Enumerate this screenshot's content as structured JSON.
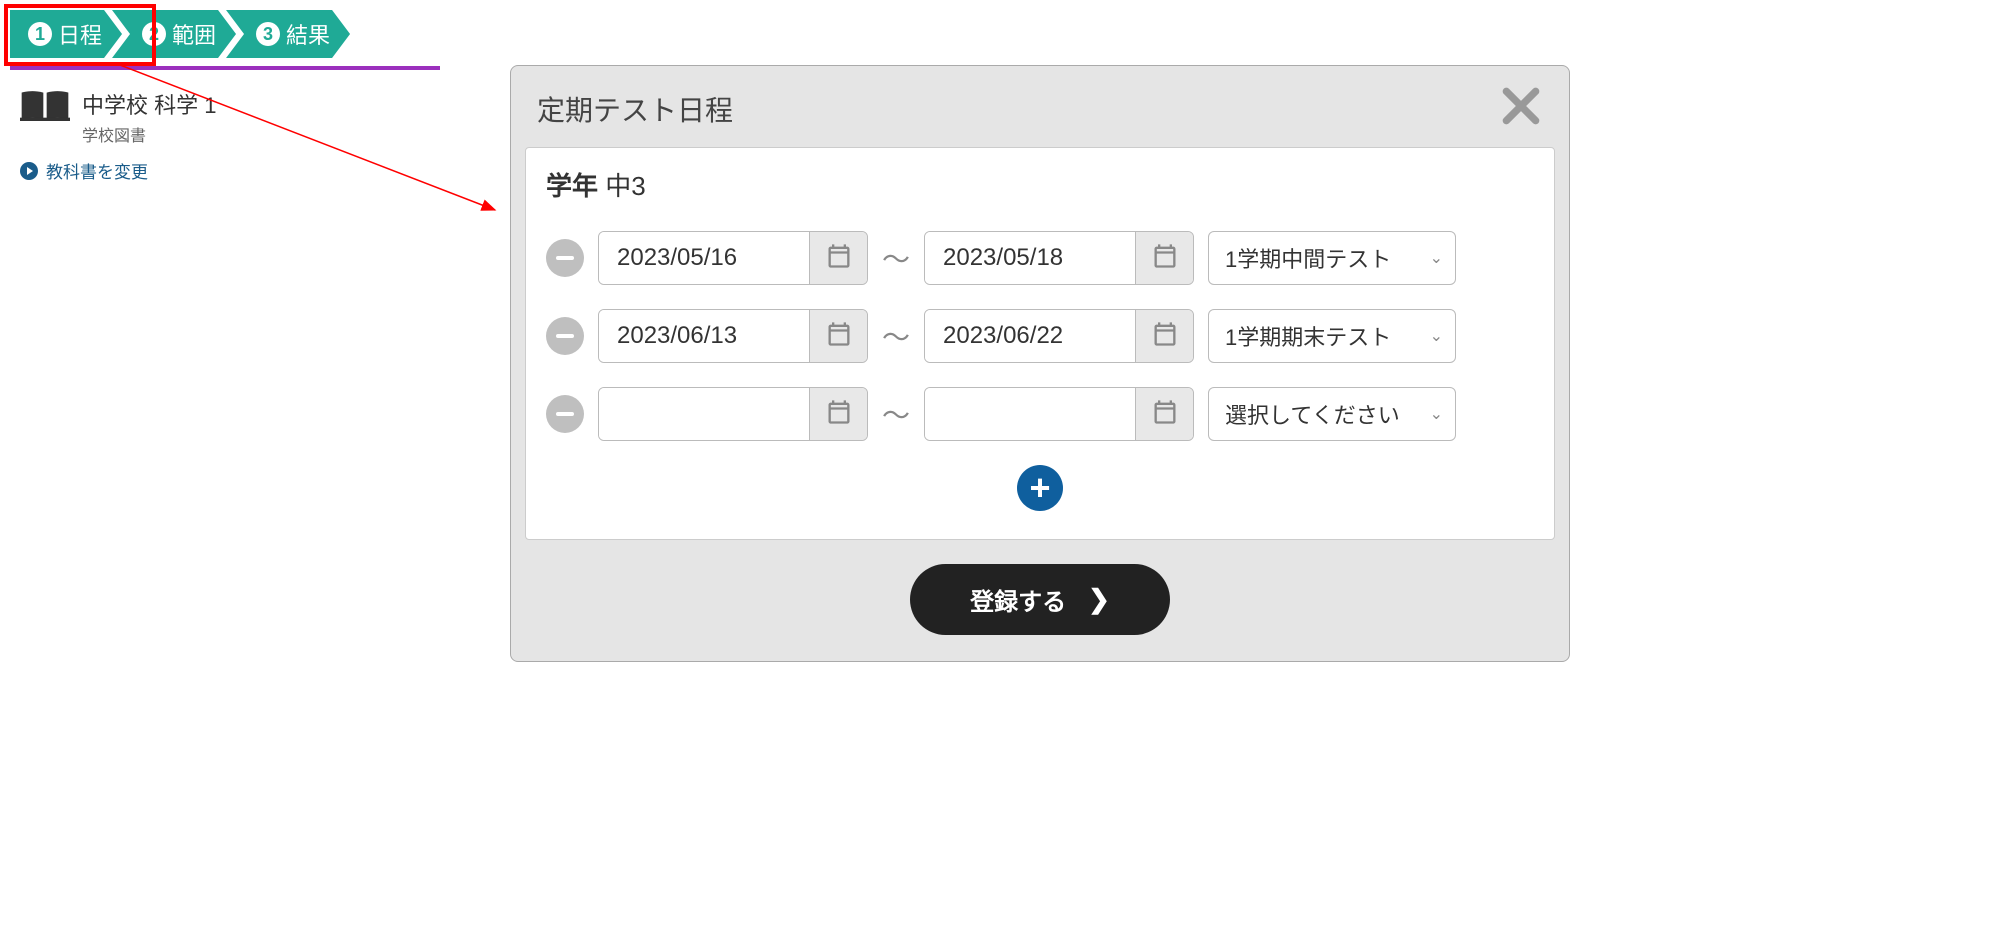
{
  "steps": [
    {
      "num": "1",
      "label": "日程"
    },
    {
      "num": "2",
      "label": "範囲"
    },
    {
      "num": "3",
      "label": "結果"
    }
  ],
  "book": {
    "title": "中学校 科学  1",
    "publisher": "学校図書",
    "change_label": "教科書を変更"
  },
  "dialog": {
    "title": "定期テスト日程",
    "grade_label": "学年",
    "grade_value": "中3",
    "tilde": "〜",
    "rows": [
      {
        "startDate": "2023/05/16",
        "endDate": "2023/05/18",
        "testName": "1学期中間テスト"
      },
      {
        "startDate": "2023/06/13",
        "endDate": "2023/06/22",
        "testName": "1学期期末テスト"
      },
      {
        "startDate": "",
        "endDate": "",
        "testName": "選択してください"
      }
    ],
    "submit_label": "登録する"
  }
}
